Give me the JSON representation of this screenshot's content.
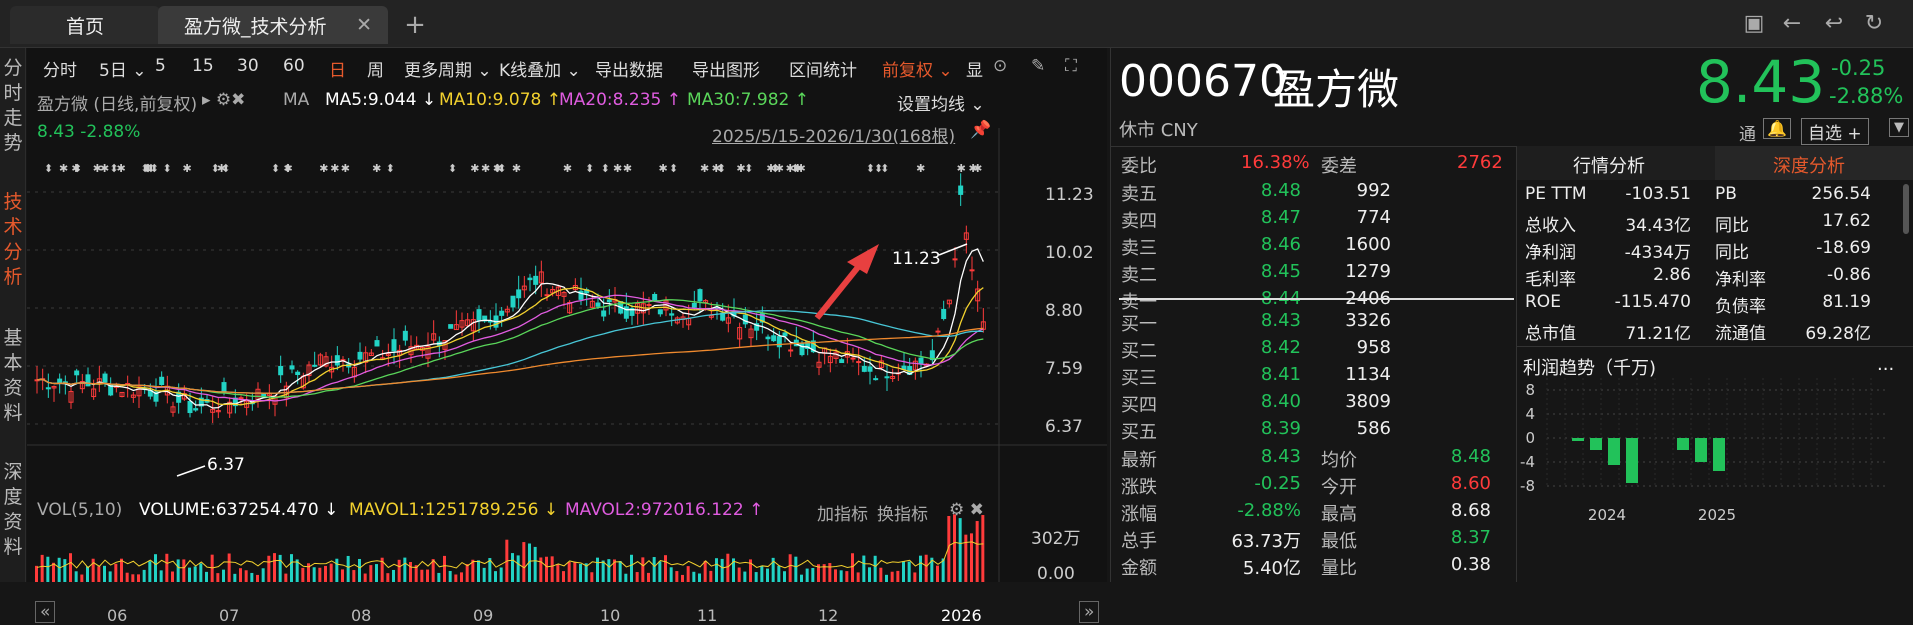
{
  "tabs": {
    "home": "首页",
    "active": "盈方微_技术分析",
    "close": "✕",
    "add": "+"
  },
  "sidebar": [
    "分时走势",
    "技术分析",
    "基本资料",
    "深度资料"
  ],
  "toolbar": [
    "分时",
    "5日 ⌄",
    "5",
    "15",
    "30",
    "60",
    "日",
    "周",
    "更多周期 ⌄",
    "K线叠加 ⌄",
    "导出数据",
    "导出图形",
    "区间统计",
    "前复权 ⌄",
    "显"
  ],
  "info": {
    "name": "盈方微 (日线,前复权)",
    "ma": "MA",
    "ma5": "MA5:9.044 ↓",
    "ma10": "MA10:9.078 ↑",
    "ma20": "MA20:8.235 ↑",
    "ma30": "MA30:7.982 ↑",
    "set": "设置均线 ⌄",
    "price": "8.43 -2.88%",
    "range": "2025/5/15-2026/1/30(168根)",
    "high_label": "11.23",
    "low_label": "6.37"
  },
  "y_axis": [
    "11.23",
    "10.02",
    "8.80",
    "7.59",
    "6.37"
  ],
  "vol": {
    "title": "VOL(5,10)",
    "volume": "VOLUME:637254.470 ↓",
    "mavol1": "MAVOL1:1251789.256 ↓",
    "mavol2": "MAVOL2:972016.122 ↑",
    "add": "加指标",
    "swap": "换指标",
    "ymax": "302万",
    "ymin": "0.00"
  },
  "x_axis": [
    "06",
    "07",
    "08",
    "09",
    "10",
    "11",
    "12",
    "2026"
  ],
  "colors": {
    "up": "#ff3b3b",
    "down": "#22d3c5",
    "ma5": "#ffffff",
    "ma10": "#f2d12e",
    "ma20": "#e05ce0",
    "ma30": "#5ad65a"
  },
  "stock": {
    "code": "000670",
    "name": "盈方微",
    "price": "8.43",
    "change": "-0.25",
    "pct": "-2.88%",
    "status": "休市 CNY",
    "tong": "通",
    "watch": "自选 +"
  },
  "order": {
    "wb_label": "委比",
    "wb": "16.38%",
    "wc_label": "委差",
    "wc": "2762",
    "asks": [
      {
        "l": "卖五",
        "p": "8.48",
        "v": "992"
      },
      {
        "l": "卖四",
        "p": "8.47",
        "v": "774"
      },
      {
        "l": "卖三",
        "p": "8.46",
        "v": "1600"
      },
      {
        "l": "卖二",
        "p": "8.45",
        "v": "1279"
      },
      {
        "l": "卖一",
        "p": "8.44",
        "v": "2406"
      }
    ],
    "bids": [
      {
        "l": "买一",
        "p": "8.43",
        "v": "3326"
      },
      {
        "l": "买二",
        "p": "8.42",
        "v": "958"
      },
      {
        "l": "买三",
        "p": "8.41",
        "v": "1134"
      },
      {
        "l": "买四",
        "p": "8.40",
        "v": "3809"
      },
      {
        "l": "买五",
        "p": "8.39",
        "v": "586"
      }
    ]
  },
  "stats": [
    {
      "a": "最新",
      "b": "8.43",
      "c": "均价",
      "d": "8.48"
    },
    {
      "a": "涨跌",
      "b": "-0.25",
      "c": "今开",
      "d": "8.60"
    },
    {
      "a": "涨幅",
      "b": "-2.88%",
      "c": "最高",
      "d": "8.68"
    },
    {
      "a": "总手",
      "b": "63.73万",
      "c": "最低",
      "d": "8.37"
    },
    {
      "a": "金额",
      "b": "5.40亿",
      "c": "量比",
      "d": "0.38"
    }
  ],
  "right_tabs": {
    "a": "行情分析",
    "b": "深度分析"
  },
  "fund": [
    {
      "a": "PE TTM",
      "b": "-103.51",
      "c": "PB",
      "d": "256.54"
    },
    {
      "a": "总收入",
      "b": "34.43亿",
      "c": "同比",
      "d": "17.62"
    },
    {
      "a": "净利润",
      "b": "-4334万",
      "c": "同比",
      "d": "-18.69"
    },
    {
      "a": "毛利率",
      "b": "2.86",
      "c": "净利率",
      "d": "-0.86"
    },
    {
      "a": "ROE",
      "b": "-115.470",
      "c": "负债率",
      "d": "81.19"
    },
    {
      "a": "总市值",
      "b": "71.21亿",
      "c": "流通值",
      "d": "69.28亿"
    }
  ],
  "profit": {
    "title": "利润趋势（千万)",
    "more": "...",
    "y": [
      "8",
      "4",
      "0",
      "-4",
      "-8"
    ],
    "x": [
      "2024",
      "2025"
    ],
    "values": [
      -0.5,
      -2,
      -4.5,
      -7.5,
      -2,
      -4,
      -5.5
    ]
  }
}
